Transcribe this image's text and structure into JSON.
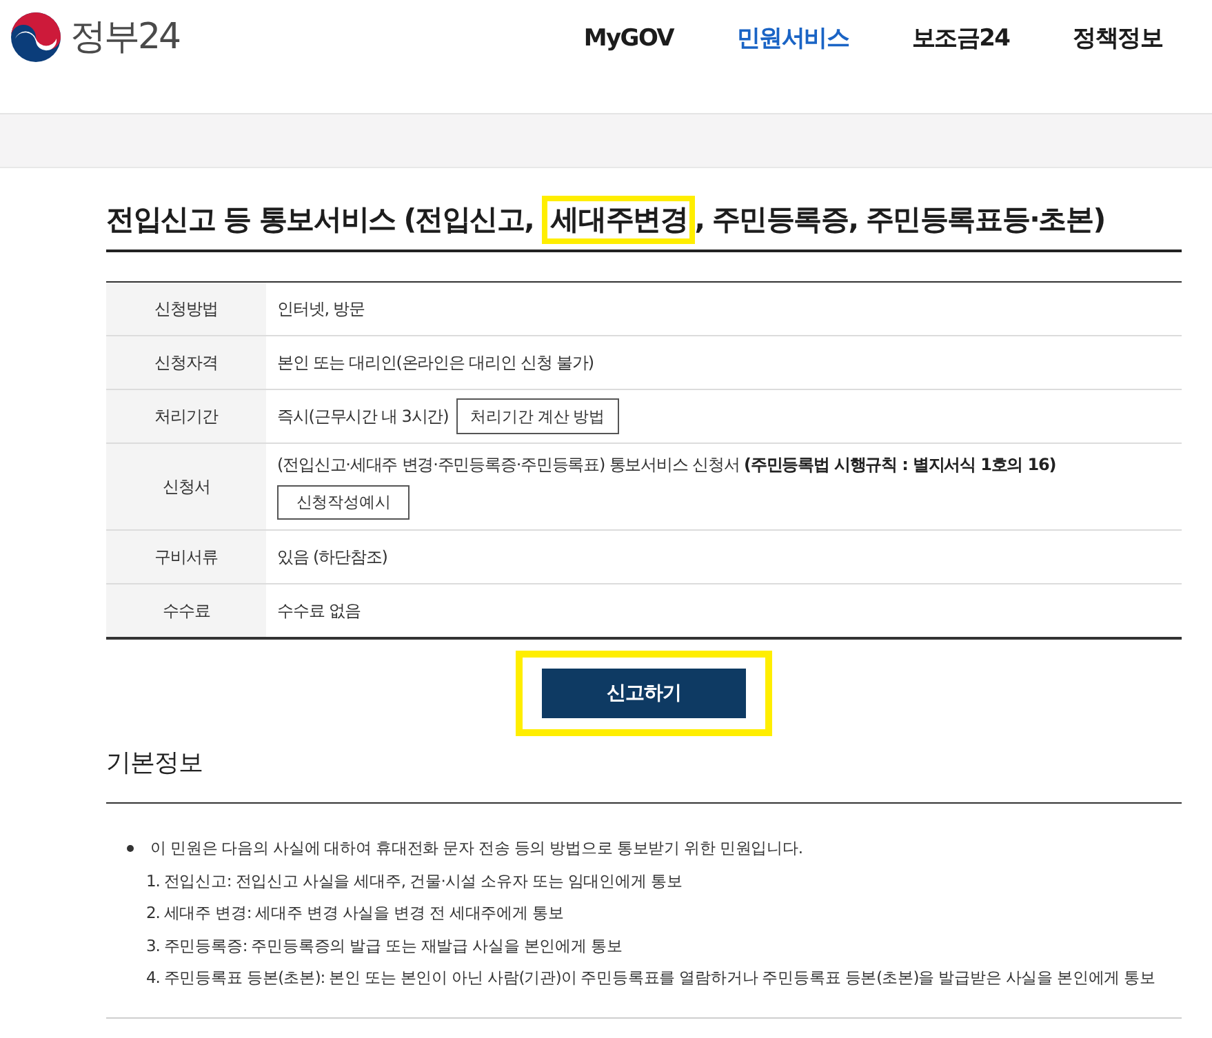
{
  "header": {
    "logo": {
      "text": "정부24"
    },
    "nav": [
      {
        "label": "MyGOV",
        "selected": false
      },
      {
        "label": "민원서비스",
        "selected": true
      },
      {
        "label": "보조금24",
        "selected": false
      },
      {
        "label": "정책정보",
        "selected": false
      }
    ]
  },
  "title": {
    "parts": [
      {
        "text": "전입신고 등 통보서비스 (전입신고, ",
        "highlighted": false
      },
      {
        "text": "세대주변경",
        "highlighted": true
      },
      {
        "text": ", 주민등록증, 주민등록표등·초본)",
        "highlighted": false
      }
    ]
  },
  "table": {
    "rows": [
      {
        "kind": "plain",
        "label": "신청방법",
        "value": "인터넷, 방문"
      },
      {
        "kind": "plain",
        "label": "신청자격",
        "value": "본인 또는 대리인(온라인은 대리인 신청 불가)"
      },
      {
        "kind": "inline-button",
        "label": "처리기간",
        "value": "즉시(근무시간 내 3시간)",
        "button": "처리기간 계산 방법"
      },
      {
        "kind": "stacked-button",
        "label": "신청서",
        "value": "(전입신고·세대주 변경·주민등록증·주민등록표) 통보서비스 신청서 **(주민등록법 시행규칙 : 별지서식 1호의 16)**",
        "button": "신청작성예시"
      },
      {
        "kind": "plain",
        "label": "구비서류",
        "value": "있음 (하단참조)"
      },
      {
        "kind": "plain",
        "label": "수수료",
        "value": "수수료 없음"
      }
    ]
  },
  "action_button": {
    "label": "신고하기",
    "highlighted": true
  },
  "basic_info": {
    "heading": "기본정보",
    "items": [
      {
        "text": "이 민원은 다음의 사실에 대하여 휴대전화 문자 전송 등의 방법으로 통보받기 위한 민원입니다.",
        "children": [
          {
            "text": "1. 전입신고: 전입신고 사실을 세대주, 건물·시설 소유자 또는 임대인에게 통보"
          },
          {
            "text": "2. 세대주 변경: 세대주 변경 사실을 변경 전 세대주에게 통보"
          },
          {
            "text": "3. 주민등록증: 주민등록증의 발급 또는 재발급 사실을 본인에게 통보"
          },
          {
            "text": "4. 주민등록표 등본(초본): 본인 또는 본인이 아닌 사람(기관)이 주민등록표를 열람하거나 주민등록표 등본(초본)을 발급받은 사실을 본인에게 통보"
          }
        ]
      }
    ]
  }
}
